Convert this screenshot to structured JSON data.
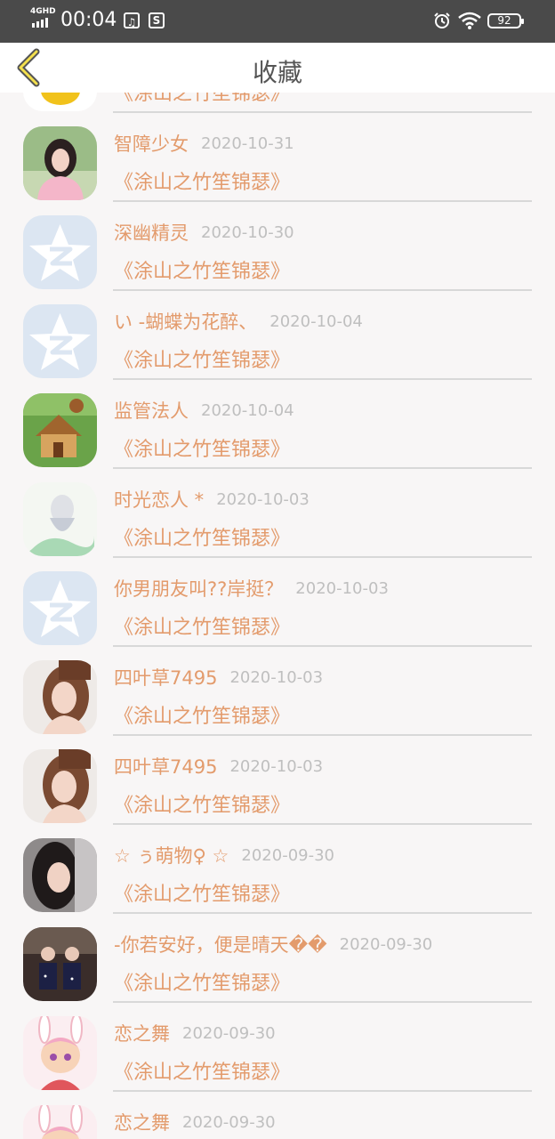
{
  "status": {
    "network": "4GHD",
    "time": "00:04",
    "battery": "92"
  },
  "header": {
    "title": "收藏"
  },
  "items": [
    {
      "name": "",
      "date": "",
      "book": "《涂山之竹笙锦瑟》",
      "avatar": "yellow-cartoon"
    },
    {
      "name": "智障少女",
      "date": "2020-10-31",
      "book": "《涂山之竹笙锦瑟》",
      "avatar": "girl-pink"
    },
    {
      "name": "深幽精灵",
      "date": "2020-10-30",
      "book": "《涂山之竹笙锦瑟》",
      "avatar": "qzone-default"
    },
    {
      "name": "い -蝴蝶为花醉、",
      "date": "2020-10-04",
      "book": "《涂山之竹笙锦瑟》",
      "avatar": "qzone-default"
    },
    {
      "name": "监管法人",
      "date": "2020-10-04",
      "book": "《涂山之竹笙锦瑟》",
      "avatar": "game-house"
    },
    {
      "name": "时光恋人 *",
      "date": "2020-10-03",
      "book": "《涂山之竹笙锦瑟》",
      "avatar": "anime-sketch"
    },
    {
      "name": "你男朋友叫??岸挺？",
      "date": "2020-10-03",
      "book": "《涂山之竹笙锦瑟》",
      "avatar": "qzone-default"
    },
    {
      "name": "四叶草7495",
      "date": "2020-10-03",
      "book": "《涂山之竹笙锦瑟》",
      "avatar": "girl-brown-hair"
    },
    {
      "name": "四叶草7495",
      "date": "2020-10-03",
      "book": "《涂山之竹笙锦瑟》",
      "avatar": "girl-brown-hair"
    },
    {
      "name": "☆ ぅ萌物♀ ☆",
      "date": "2020-09-30",
      "book": "《涂山之竹笙锦瑟》",
      "avatar": "girl-dark-hair"
    },
    {
      "name": "-你若安好，便是晴天��",
      "date": "2020-09-30",
      "book": "《涂山之竹笙锦瑟》",
      "avatar": "group-photo"
    },
    {
      "name": "恋之舞",
      "date": "2020-09-30",
      "book": "《涂山之竹笙锦瑟》",
      "avatar": "anime-bunny"
    },
    {
      "name": "恋之舞",
      "date": "2020-09-30",
      "book": "",
      "avatar": "anime-bunny"
    }
  ],
  "colors": {
    "accent": "#e39b6c",
    "date": "#bfbfbf",
    "qzone_bg": "#dce6f2"
  }
}
